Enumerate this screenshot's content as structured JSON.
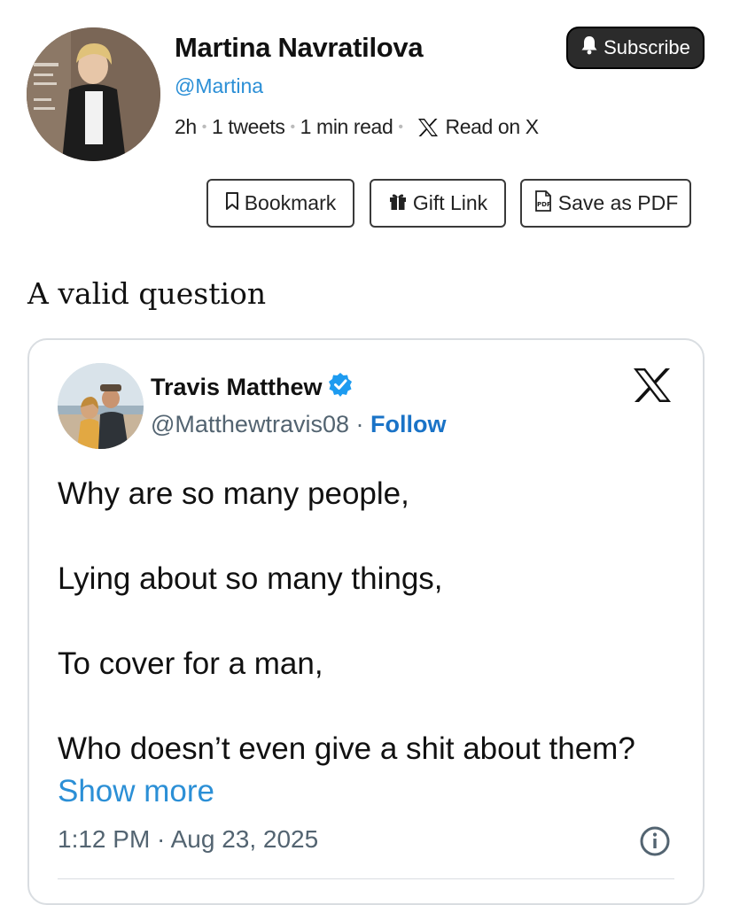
{
  "author": {
    "name": "Martina Navratilova",
    "handle": "@Martina",
    "meta": {
      "age": "2h",
      "tweets": "1 tweets",
      "read_time": "1 min read",
      "read_on_x": "Read on X"
    }
  },
  "subscribe_label": "Subscribe",
  "actions": {
    "bookmark": "Bookmark",
    "gift_link": "Gift Link",
    "save_pdf": "Save as PDF"
  },
  "post_text": "A valid question",
  "tweet": {
    "name": "Travis Matthew",
    "handle": "@Matthewtravis08",
    "separator": "·",
    "follow_label": "Follow",
    "lines": [
      "Why are so many people,",
      "Lying about so many things,",
      "To cover for a man,",
      "Who doesn’t even give a shit about them?"
    ],
    "show_more": "Show more",
    "timestamp": "1:12 PM · Aug 23, 2025"
  },
  "colors": {
    "link_blue": "#2b8fd6",
    "follow_blue": "#1a73c7",
    "verified_blue": "#1d9bf0",
    "subscribe_bg": "#2b2b2b"
  },
  "icons": [
    "bell-icon",
    "bookmark-icon",
    "gift-icon",
    "pdf-icon",
    "x-logo-icon",
    "verified-badge-icon",
    "info-icon"
  ]
}
